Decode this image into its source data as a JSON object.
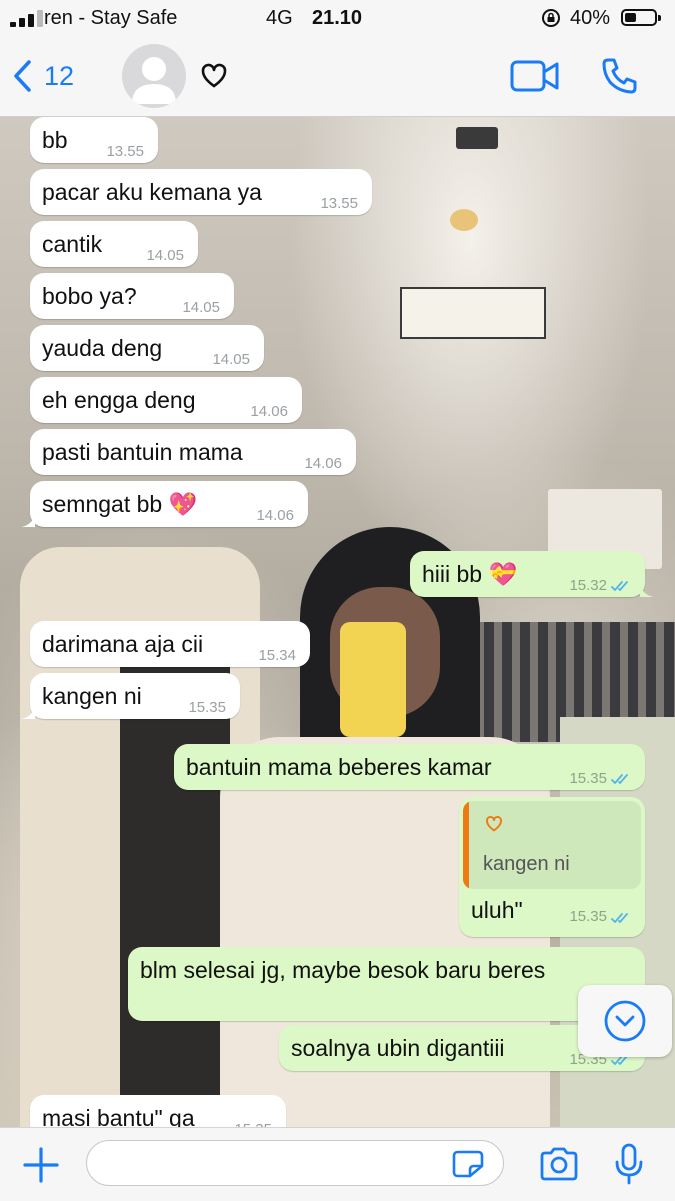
{
  "status_bar": {
    "carrier": "ren - Stay Safe",
    "network": "4G",
    "time": "21.10",
    "battery": "40%",
    "battery_level": 0.4
  },
  "header": {
    "back_count": "12",
    "contact_name_icon": "heart-icon",
    "accent_color": "#1a7cf5"
  },
  "messages": [
    {
      "dir": "in",
      "text": "bb",
      "time": "13.55"
    },
    {
      "dir": "in",
      "text": "pacar aku kemana ya",
      "time": "13.55"
    },
    {
      "dir": "in",
      "text": "cantik",
      "time": "14.05"
    },
    {
      "dir": "in",
      "text": "bobo ya?",
      "time": "14.05"
    },
    {
      "dir": "in",
      "text": "yauda deng",
      "time": "14.05"
    },
    {
      "dir": "in",
      "text": "eh engga deng",
      "time": "14.06"
    },
    {
      "dir": "in",
      "text": "pasti bantuin mama",
      "time": "14.06"
    },
    {
      "dir": "in",
      "text": "semngat bb 💖",
      "time": "14.06"
    },
    {
      "dir": "out",
      "text": "hiii bb 💝",
      "time": "15.32",
      "status": "read"
    },
    {
      "dir": "in",
      "text": "darimana aja cii",
      "time": "15.34"
    },
    {
      "dir": "in",
      "text": "kangen ni",
      "time": "15.35"
    },
    {
      "dir": "out",
      "text": "bantuin mama beberes kamar",
      "time": "15.35",
      "status": "read"
    },
    {
      "dir": "out",
      "text": "uluh\"",
      "time": "15.35",
      "status": "read",
      "quoted_text": "kangen ni",
      "quoted_icon": "heart-icon"
    },
    {
      "dir": "out",
      "text": "blm selesai jg, maybe besok baru beres",
      "time": "15",
      "status": "read"
    },
    {
      "dir": "out",
      "text": "soalnya ubin digantiii",
      "time": "15.35",
      "status": "read"
    },
    {
      "dir": "in",
      "text": "masi bantu\" ga",
      "time": "15.35"
    }
  ],
  "colors": {
    "incoming_bubble": "#ffffff",
    "outgoing_bubble": "#dcf8c6",
    "read_ticks": "#4fb5ec",
    "quote_bar": "#f07a12"
  },
  "input": {
    "placeholder": ""
  }
}
